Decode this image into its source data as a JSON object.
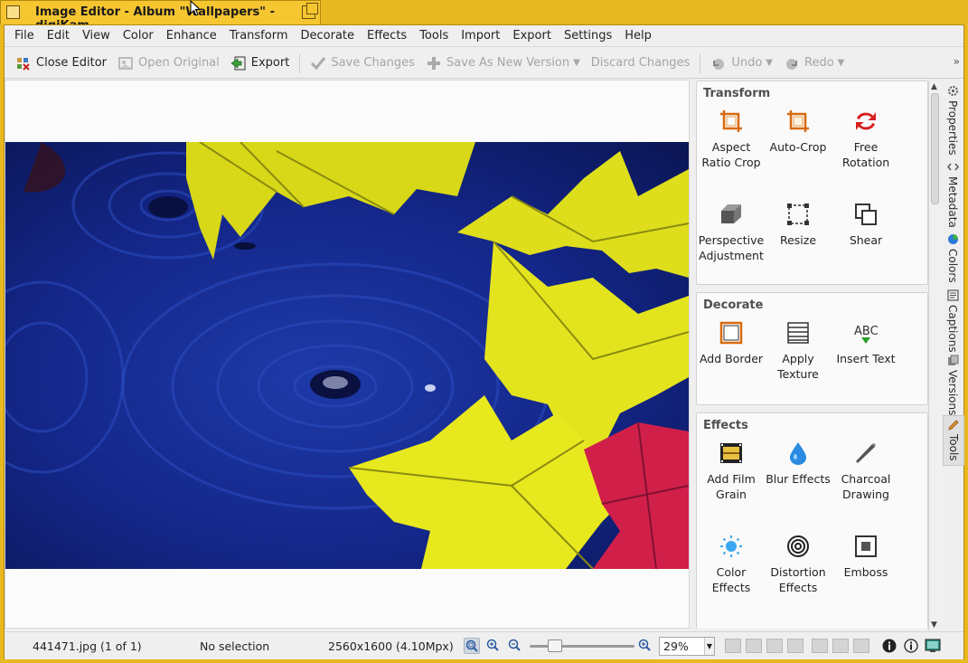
{
  "window": {
    "title": "Image Editor - Album \"Wallpapers\" - digiKam"
  },
  "menu": [
    "File",
    "Edit",
    "View",
    "Color",
    "Enhance",
    "Transform",
    "Decorate",
    "Effects",
    "Tools",
    "Import",
    "Export",
    "Settings",
    "Help"
  ],
  "toolbar": {
    "close_editor": "Close Editor",
    "open_original": "Open Original",
    "export": "Export",
    "save_changes": "Save Changes",
    "save_new_version": "Save As New Version",
    "discard_changes": "Discard Changes",
    "undo": "Undo",
    "redo": "Redo",
    "more": "»"
  },
  "tools_panel": {
    "transform": {
      "title": "Transform",
      "items": [
        {
          "label": "Aspect Ratio Crop",
          "icon": "crop-ratio-icon"
        },
        {
          "label": "Auto-Crop",
          "icon": "auto-crop-icon"
        },
        {
          "label": "Free Rotation",
          "icon": "free-rotation-icon"
        },
        {
          "label": "Perspective Adjustment",
          "icon": "perspective-icon"
        },
        {
          "label": "Resize",
          "icon": "resize-icon"
        },
        {
          "label": "Shear",
          "icon": "shear-icon"
        }
      ]
    },
    "decorate": {
      "title": "Decorate",
      "items": [
        {
          "label": "Add Border",
          "icon": "border-icon"
        },
        {
          "label": "Apply Texture",
          "icon": "texture-icon"
        },
        {
          "label": "Insert Text",
          "icon": "insert-text-icon"
        }
      ]
    },
    "effects": {
      "title": "Effects",
      "items": [
        {
          "label": "Add Film Grain",
          "icon": "film-grain-icon"
        },
        {
          "label": "Blur Effects",
          "icon": "blur-drop-icon"
        },
        {
          "label": "Charcoal Drawing",
          "icon": "charcoal-icon"
        },
        {
          "label": "Color Effects",
          "icon": "color-effects-icon"
        },
        {
          "label": "Distortion Effects",
          "icon": "distortion-icon"
        },
        {
          "label": "Emboss",
          "icon": "emboss-icon"
        }
      ]
    }
  },
  "side_tabs": [
    "Properties",
    "Metadata",
    "Colors",
    "Captions",
    "Versions",
    "Tools"
  ],
  "status": {
    "file": "441471.jpg (1 of 1)",
    "selection": "No selection",
    "dimensions": "2560x1600 (4.10Mpx)",
    "zoom": "29%"
  },
  "colors": {
    "title_bar": "#f6c630",
    "frame": "#e8b820",
    "water": "#12207a",
    "leaf_yellow": "#e6e418",
    "leaf_red": "#d0204a"
  }
}
